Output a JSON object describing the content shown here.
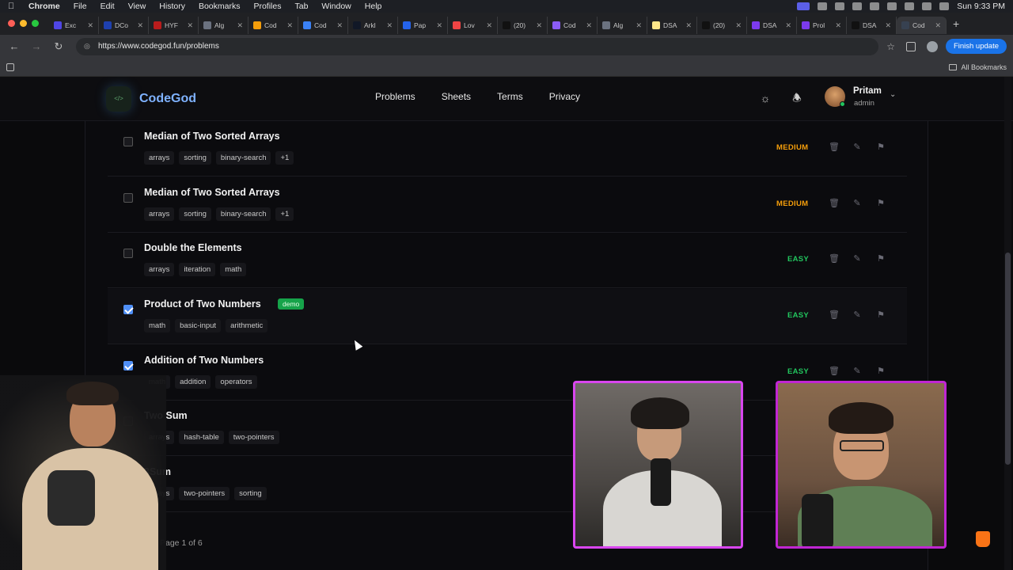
{
  "menubar": {
    "app": "Chrome",
    "items": [
      "File",
      "Edit",
      "View",
      "History",
      "Bookmarks",
      "Profiles",
      "Tab",
      "Window",
      "Help"
    ],
    "clock": "Sun 9:33 PM"
  },
  "tabs": [
    {
      "label": "Exc",
      "color": "#4f46e5"
    },
    {
      "label": "DCo",
      "color": "#1e40af"
    },
    {
      "label": "HYF",
      "color": "#b91c1c"
    },
    {
      "label": "Alg",
      "color": "#6b7280"
    },
    {
      "label": "Cod",
      "color": "#f59e0b"
    },
    {
      "label": "Cod",
      "color": "#3b82f6"
    },
    {
      "label": "Arkl",
      "color": "#111827"
    },
    {
      "label": "Pap",
      "color": "#2563eb"
    },
    {
      "label": "Lov",
      "color": "#ef4444"
    },
    {
      "label": "(20)",
      "color": "#111111"
    },
    {
      "label": "Cod",
      "color": "#8b5cf6"
    },
    {
      "label": "Alg",
      "color": "#6b7280"
    },
    {
      "label": "DSA",
      "color": "#fde68a"
    },
    {
      "label": "(20)",
      "color": "#111111"
    },
    {
      "label": "DSA",
      "color": "#7c3aed"
    },
    {
      "label": "Prol",
      "color": "#7c3aed"
    },
    {
      "label": "DSA",
      "color": "#111111"
    },
    {
      "label": "Cod",
      "color": "#374151",
      "active": true
    }
  ],
  "address": {
    "url": "https://www.codegod.fun/problems",
    "finish_update": "Finish update",
    "all_bookmarks": "All Bookmarks"
  },
  "site": {
    "brand": "CodeGod",
    "logo_text": "</>",
    "nav": [
      "Problems",
      "Sheets",
      "Terms",
      "Privacy"
    ],
    "user": {
      "name": "Pritam",
      "role": "admin"
    }
  },
  "problems": [
    {
      "title": "Median of Two Sorted Arrays",
      "tags": [
        "arrays",
        "sorting",
        "binary-search",
        "+1"
      ],
      "difficulty": "MEDIUM",
      "checked": false,
      "demo": ""
    },
    {
      "title": "Median of Two Sorted Arrays",
      "tags": [
        "arrays",
        "sorting",
        "binary-search",
        "+1"
      ],
      "difficulty": "MEDIUM",
      "checked": false,
      "demo": ""
    },
    {
      "title": "Double the Elements",
      "tags": [
        "arrays",
        "iteration",
        "math"
      ],
      "difficulty": "EASY",
      "checked": false,
      "demo": ""
    },
    {
      "title": "Product of Two Numbers",
      "tags": [
        "math",
        "basic-input",
        "arithmetic"
      ],
      "difficulty": "EASY",
      "checked": true,
      "demo": "demo"
    },
    {
      "title": "Addition of Two Numbers",
      "tags": [
        "math",
        "addition",
        "operators"
      ],
      "difficulty": "EASY",
      "checked": true,
      "demo": ""
    },
    {
      "title": "Two Sum",
      "tags": [
        "arrays",
        "hash-table",
        "two-pointers"
      ],
      "difficulty": "",
      "checked": false,
      "demo": ""
    },
    {
      "title": "3Sum",
      "tags": [
        "arrays",
        "two-pointers",
        "sorting"
      ],
      "difficulty": "",
      "checked": false,
      "demo": ""
    }
  ],
  "pagination": "Page 1 of 6"
}
